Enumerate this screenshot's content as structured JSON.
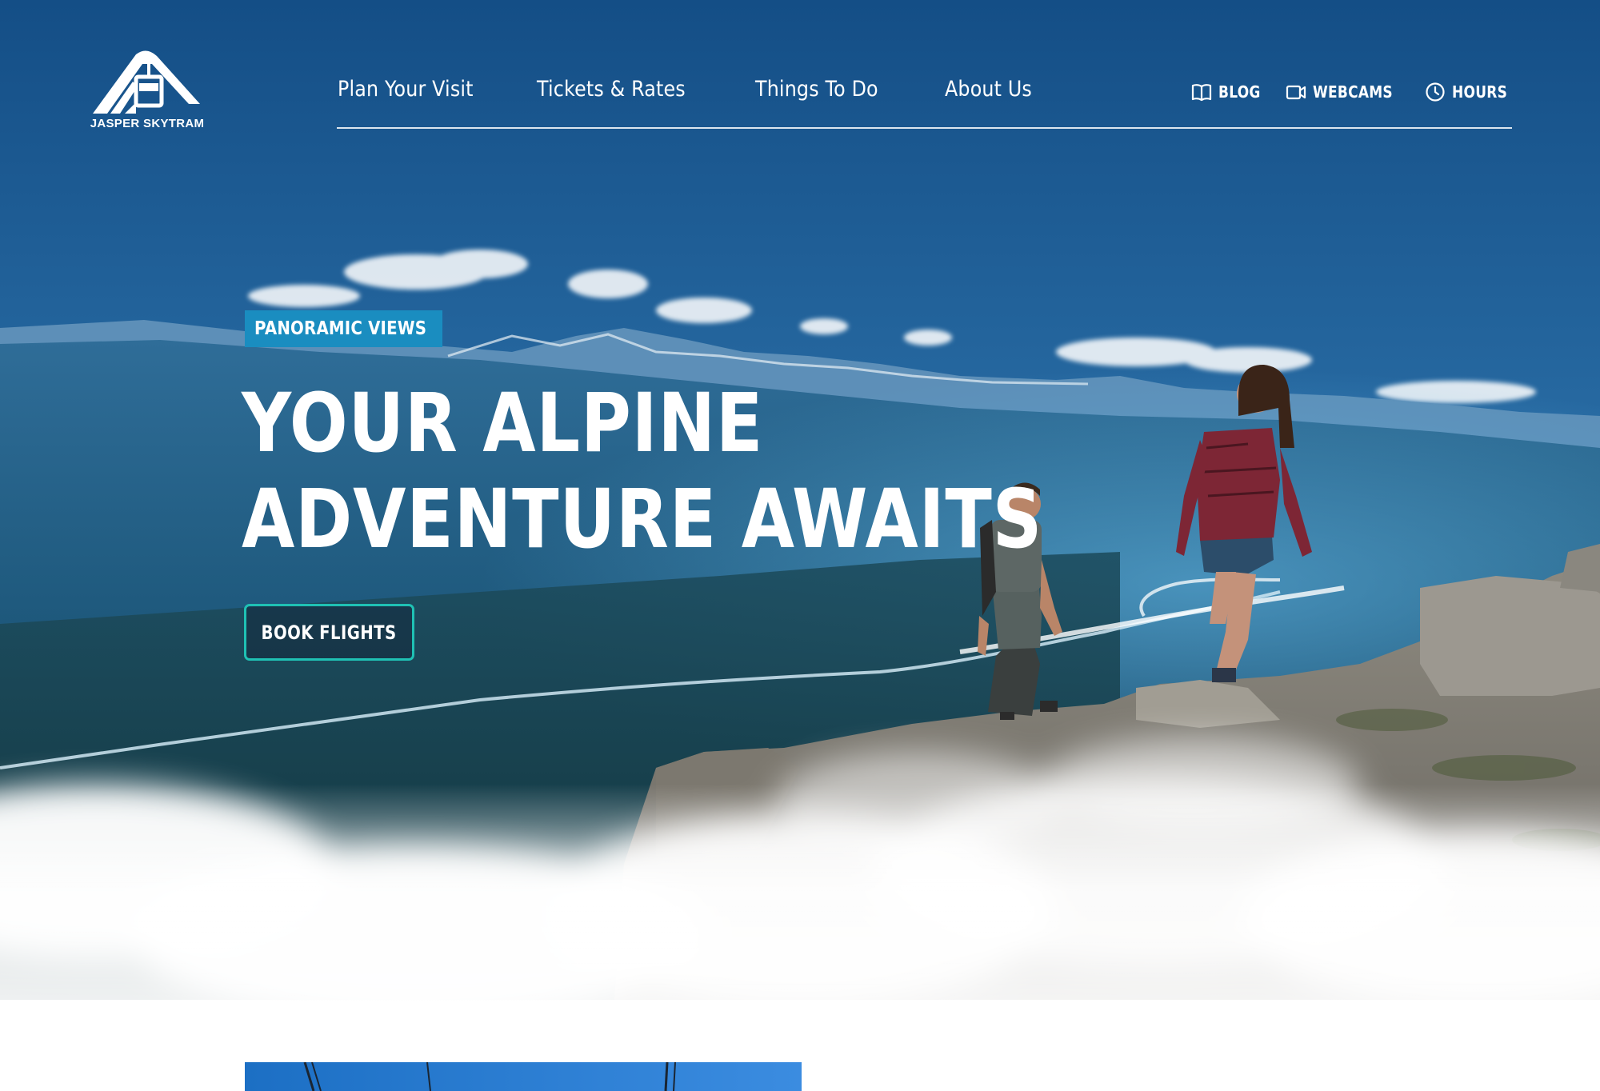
{
  "brand": {
    "logo_text": "JASPER SKYTRAM",
    "logo_icon": "skytram-mountain-logo-icon"
  },
  "nav": {
    "items": [
      {
        "label": "Plan Your Visit"
      },
      {
        "label": "Tickets & Rates"
      },
      {
        "label": "Things To Do"
      },
      {
        "label": "About Us"
      }
    ]
  },
  "utility_nav": {
    "items": [
      {
        "label": "BLOG",
        "icon": "book-icon"
      },
      {
        "label": "WEBCAMS",
        "icon": "video-camera-icon"
      },
      {
        "label": "HOURS",
        "icon": "clock-icon"
      }
    ]
  },
  "hero": {
    "badge": "PANORAMIC VIEWS",
    "headline_line1": "YOUR ALPINE",
    "headline_line2": "ADVENTURE AWAITS",
    "cta_label": "BOOK FLIGHTS"
  },
  "colors": {
    "badge_bg": "#1a8dc0",
    "cta_border": "#1fc1b4",
    "sky_top": "#144e86",
    "cloud_white": "#ffffff"
  }
}
